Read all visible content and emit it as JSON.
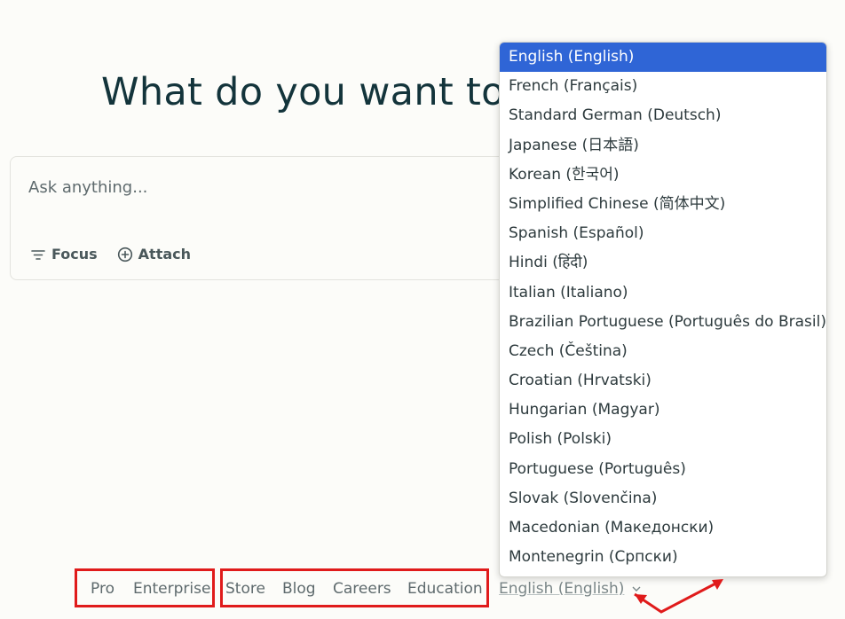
{
  "headline": "What do you want to",
  "ask": {
    "placeholder": "Ask anything...",
    "focus_label": "Focus",
    "attach_label": "Attach"
  },
  "footer": {
    "links_group1": [
      "Pro",
      "Enterprise"
    ],
    "links_group2": [
      "Store",
      "Blog",
      "Careers",
      "Education"
    ],
    "language_selected": "English (English)"
  },
  "language_dropdown": {
    "selected_index": 0,
    "options": [
      "English (English)",
      "French (Français)",
      "Standard German (Deutsch)",
      "Japanese (日本語)",
      "Korean (한국어)",
      "Simplified Chinese (简体中文)",
      "Spanish (Español)",
      "Hindi (हिंदी)",
      "Italian (Italiano)",
      "Brazilian Portuguese (Português do Brasil)",
      "Czech (Čeština)",
      "Croatian (Hrvatski)",
      "Hungarian (Magyar)",
      "Polish (Polski)",
      "Portuguese (Português)",
      "Slovak (Slovenčina)",
      "Macedonian (Македонски)",
      "Montenegrin (Српски)"
    ]
  },
  "colors": {
    "annotation_red": "#e01b1b",
    "selection_blue": "#2f65d6",
    "text_dark": "#13343b"
  }
}
